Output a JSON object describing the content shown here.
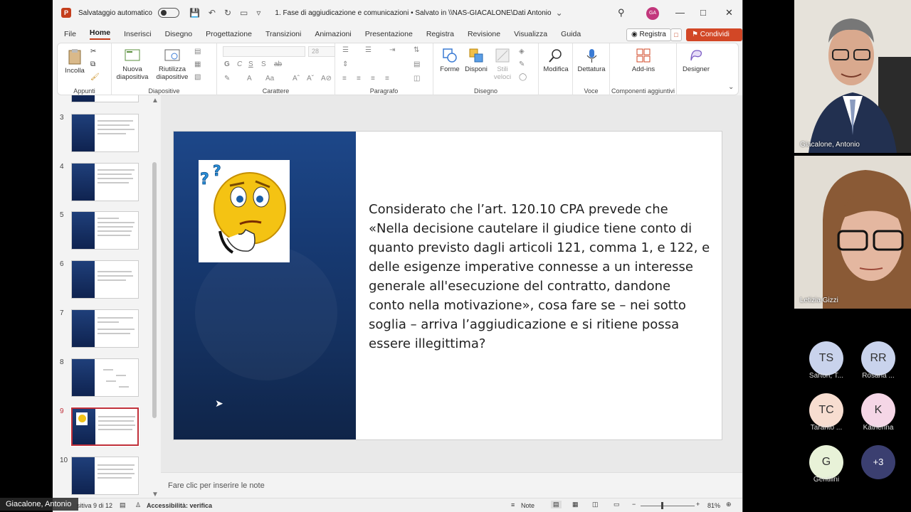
{
  "titlebar": {
    "autosave_label": "Salvataggio automatico",
    "doc_title": "1. Fase di aggiudicazione e comunicazioni • Salvato in \\\\NAS-GIACALONE\\Dati Antonio",
    "user_initials": "GA"
  },
  "menu": [
    "File",
    "Home",
    "Inserisci",
    "Disegno",
    "Progettazione",
    "Transizioni",
    "Animazioni",
    "Presentazione",
    "Registra",
    "Revisione",
    "Visualizza",
    "Guida"
  ],
  "menu_active": "Home",
  "actions": {
    "record": "Registra",
    "share": "Condividi"
  },
  "ribbon": {
    "paste": "Incolla",
    "new_slide": "Nuova diapositiva",
    "reuse": "Riutilizza diapositive",
    "font_size": "28",
    "shapes": "Forme",
    "arrange": "Disponi",
    "styles": "Stili veloci",
    "edit": "Modifica",
    "dictate": "Dettatura",
    "addins": "Add-ins",
    "designer": "Designer",
    "groups": {
      "clipboard": "Appunti",
      "slides": "Diapositive",
      "font": "Carattere",
      "paragraph": "Paragrafo",
      "drawing": "Disegno",
      "voice": "Voce",
      "addins": "Componenti aggiuntivi"
    }
  },
  "thumbnails": [
    "3",
    "4",
    "5",
    "6",
    "7",
    "8",
    "9",
    "10"
  ],
  "selected_slide": "9",
  "slide": {
    "text": "Considerato che l’art. 120.10 CPA prevede che «Nella decisione cautelare il giudice tiene conto di quanto previsto dagli articoli 121, comma 1, e 122, e delle esigenze imperative connesse a un interesse generale all'esecuzione del contratto, dandone conto nella motivazione», cosa fare se – nei sotto soglia – arriva l’aggiudicazione e si ritiene possa essere illegittima?"
  },
  "notes_placeholder": "Fare clic per inserire le note",
  "status": {
    "slide_info": "sitiva 9 di 12",
    "accessibility": "Accessibilità: verifica",
    "notes": "Note",
    "zoom": "81%"
  },
  "presenter_badge": "Giacalone, Antonio",
  "video": {
    "tile1_name": "Giacalone, Antonio",
    "tile2_name": "Letizia Gizzi"
  },
  "participants": [
    {
      "initials": "TS",
      "label": "Sartori, T...",
      "color": "#c9d3ec"
    },
    {
      "initials": "RR",
      "label": "Rosaria ...",
      "color": "#c9d3ec"
    },
    {
      "initials": "TC",
      "label": "Taranto ...",
      "color": "#f7ddd0"
    },
    {
      "initials": "K",
      "label": "Katherina",
      "color": "#f5d6e6"
    },
    {
      "initials": "G",
      "label": "Gentilini",
      "color": "#e8f2d8"
    },
    {
      "initials": "+3",
      "label": "",
      "color": "#3b3f70"
    }
  ]
}
